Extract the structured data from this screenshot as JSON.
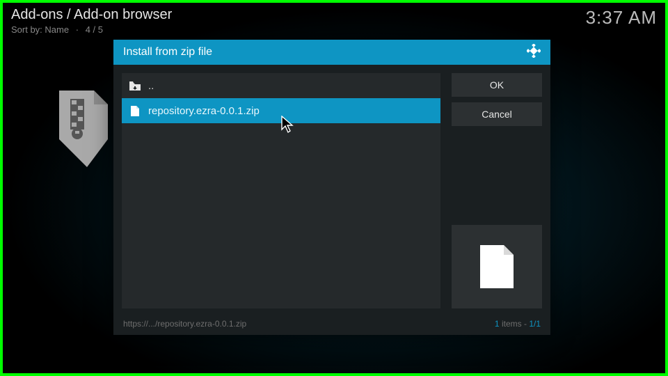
{
  "header": {
    "title": "Add-ons / Add-on browser",
    "sort_label": "Sort by: Name",
    "position": "4 / 5",
    "clock": "3:37 AM"
  },
  "dialog": {
    "title": "Install from zip file",
    "parent_label": "..",
    "file": "repository.ezra-0.0.1.zip",
    "ok_label": "OK",
    "cancel_label": "Cancel",
    "footer_path": "https://.../repository.ezra-0.0.1.zip",
    "footer_items_word": "items",
    "footer_count": "1",
    "footer_pos": "1/1"
  }
}
